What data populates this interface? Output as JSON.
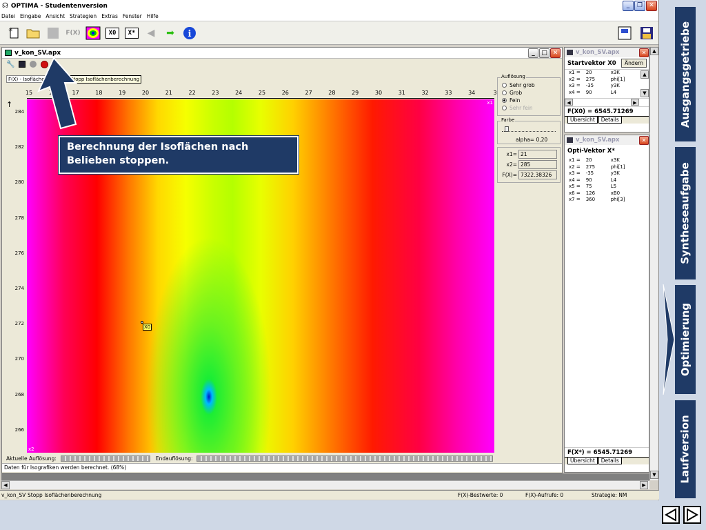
{
  "app": {
    "title": "OPTIMA - Studentenversion",
    "menu": [
      "Datei",
      "Eingabe",
      "Ansicht",
      "Strategien",
      "Extras",
      "Fenster",
      "Hilfe"
    ],
    "toolbar": {
      "fx_label": "F(X)",
      "x0_label": "X0",
      "xstar_label": "X*"
    }
  },
  "doc": {
    "title": "v_kon_SV.apx",
    "status_label": "F(X) - Isofläche",
    "tooltip": "Stopp Isoflächenberechnung",
    "x_ticks": [
      "15",
      "16",
      "17",
      "18",
      "19",
      "20",
      "21",
      "22",
      "23",
      "24",
      "25",
      "26",
      "27",
      "28",
      "29",
      "30",
      "31",
      "32",
      "33",
      "34",
      "3"
    ],
    "y_ticks": [
      "284",
      "282",
      "280",
      "278",
      "276",
      "274",
      "272",
      "270",
      "268",
      "266"
    ],
    "x0_marker": "X0",
    "axis_x1": "x1",
    "axis_x2": "x2",
    "callout": "Berechnung der Isoflächen nach Belieben stoppen.",
    "aufloesung_title": "Auflösung",
    "aufloesung_options": [
      "Sehr grob",
      "Grob",
      "Fein",
      "Sehr fein"
    ],
    "farbe_title": "Farbe",
    "alpha_label": "alpha= 0,20",
    "x1_label": "x1=",
    "x1_value": "21",
    "x2_label": "x2=",
    "x2_value": "285",
    "fx_label": "F(X)=",
    "fx_value": "7322.38326",
    "aktuelle_label": "Aktuelle Auflösung:",
    "end_label": "Endauflösung:",
    "message": "Daten für Isografiken werden berechnet. (68%)"
  },
  "start_panel": {
    "title": "v_kon_SV.apx",
    "heading": "Startvektor X0",
    "change_button": "Ändern",
    "rows": [
      [
        "x1 =",
        "20",
        "x3K"
      ],
      [
        "x2 =",
        "275",
        "phi[1]"
      ],
      [
        "x3 =",
        "-35",
        "y3K"
      ],
      [
        "x4 =",
        "90",
        "L4"
      ]
    ],
    "fx": "F(X0) = 6545.71269",
    "tabs": [
      "Übersicht",
      "Details"
    ]
  },
  "opti_panel": {
    "title": "v_kon_SV.apx",
    "heading": "Opti-Vektor X*",
    "rows": [
      [
        "x1 =",
        "20",
        "x3K"
      ],
      [
        "x2 =",
        "275",
        "phi[1]"
      ],
      [
        "x3 =",
        "-35",
        "y3K"
      ],
      [
        "x4 =",
        "90",
        "L4"
      ],
      [
        "x5 =",
        "75",
        "L5"
      ],
      [
        "x6 =",
        "126",
        "xB0"
      ],
      [
        "x7 =",
        "360",
        "phi[3]"
      ]
    ],
    "fx": "F(X*) = 6545.71269",
    "tabs": [
      "Übersicht",
      "Details"
    ]
  },
  "statusbar": {
    "file": "v_kon_SV",
    "action": "Stopp Isoflächenberechnung",
    "best": "F(X)-Bestwerte: 0",
    "calls": "F(X)-Aufrufe: 0",
    "strategy": "Strategie: NM"
  },
  "nav": {
    "tabs": [
      "Ausgangsgetriebe",
      "Syntheseaufgabe",
      "Optimierung",
      "Laufversion"
    ]
  }
}
